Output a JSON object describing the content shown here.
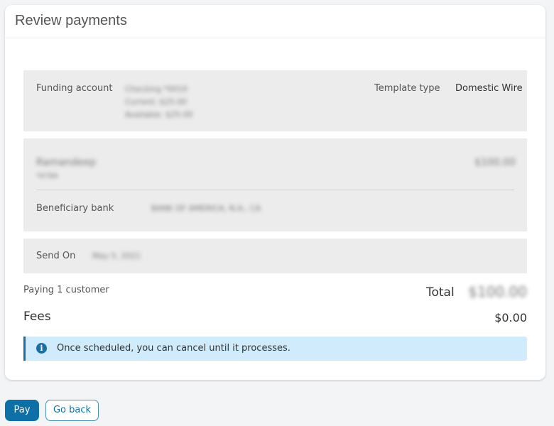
{
  "header": {
    "title": "Review payments"
  },
  "funding": {
    "label": "Funding account",
    "account_lines": [
      "Checking *0010",
      "Current: $25.00",
      "Available: $25.00"
    ],
    "template_type_label": "Template type",
    "template_type_value": "Domestic Wire"
  },
  "beneficiary": {
    "name": "Ramandeep",
    "sub": "*6789",
    "amount": "$100.00",
    "bank_label": "Beneficiary bank",
    "bank_value": "BANK OF AMERICA, N.A., CA"
  },
  "send_on": {
    "label": "Send On",
    "value": "May 5, 2021"
  },
  "summary": {
    "paying": "Paying 1 customer",
    "total_label": "Total",
    "total_value": "$100.00",
    "fees_label": "Fees",
    "fees_value": "$0.00"
  },
  "info": {
    "icon": "info-icon",
    "text": "Once scheduled, you can cancel until it processes.",
    "color": "#1c6fa3"
  },
  "actions": {
    "pay": "Pay",
    "go_back": "Go back",
    "primary_color": "#0f70a8"
  }
}
